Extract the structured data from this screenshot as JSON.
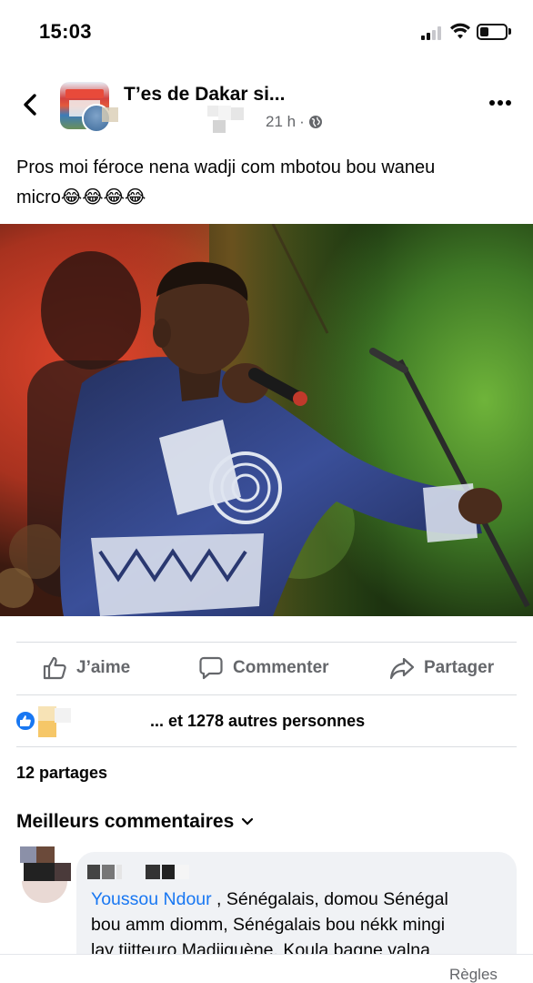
{
  "status_bar": {
    "time": "15:03",
    "signal_icon": "cellular-signal-icon",
    "wifi_icon": "wifi-icon",
    "battery_icon": "battery-icon",
    "battery_level": 0.35
  },
  "header": {
    "back_icon": "chevron-left-icon",
    "group_name": "T’es de Dakar si...",
    "post_time": "21 h",
    "separator": "·",
    "audience_icon": "globe-icon",
    "more_icon": "ellipsis-horizontal-icon"
  },
  "post": {
    "text_line1": "Pros moi féroce nena wadji com mbotou bou waneu",
    "text_line2": "micro😂😂😂😂",
    "photo_icon": "concert-singer-photo"
  },
  "actions": {
    "like_label": "J’aime",
    "comment_label": "Commenter",
    "share_label": "Partager",
    "like_icon": "thumbs-up-icon",
    "comment_icon": "speech-bubble-icon",
    "share_icon": "share-arrow-icon"
  },
  "reactions": {
    "text": "... et 1278 autres personnes",
    "like_badge_icon": "like-reaction-icon"
  },
  "shares": {
    "text": "12 partages"
  },
  "comments": {
    "header": "Meilleurs commentaires",
    "header_icon": "chevron-down-icon",
    "first": {
      "mention": "Youssou Ndour",
      "line1_rest": " , Sénégalais, domou Sénégal",
      "line2": "bou amm diomm, Sénégalais bou nékk mingi",
      "line3": "lay tijtteuro Madjiguène. Koula bagne valna"
    }
  },
  "footer": {
    "rules_label": "Règles"
  },
  "colors": {
    "accent": "#1877f2",
    "secondary_text": "#65676b",
    "bubble": "#f0f2f5",
    "divider": "#dadde1"
  }
}
